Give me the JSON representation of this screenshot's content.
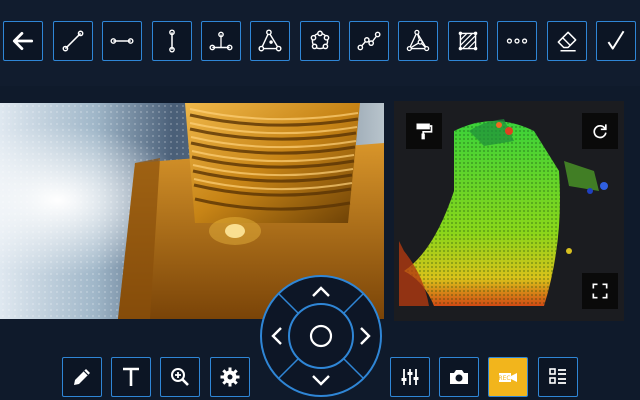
{
  "toolbar": {
    "tools": [
      {
        "name": "back-button",
        "icon": "arrow-left-icon"
      },
      {
        "name": "line-tool-button",
        "icon": "line-icon"
      },
      {
        "name": "horizontal-line-tool-button",
        "icon": "horizontal-line-icon"
      },
      {
        "name": "vertical-line-tool-button",
        "icon": "vertical-line-icon"
      },
      {
        "name": "point-to-line-tool-button",
        "icon": "point-line-icon"
      },
      {
        "name": "plane-depth-tool-button",
        "icon": "triangle-points-icon"
      },
      {
        "name": "circle-points-tool-button",
        "icon": "circle-points-icon"
      },
      {
        "name": "polyline-tool-button",
        "icon": "polyline-icon"
      },
      {
        "name": "area-mesh-tool-button",
        "icon": "mesh-icon"
      },
      {
        "name": "hatch-area-tool-button",
        "icon": "hatch-icon"
      },
      {
        "name": "more-tools-button",
        "icon": "more-icon"
      },
      {
        "name": "eraser-button",
        "icon": "eraser-icon"
      },
      {
        "name": "confirm-button",
        "icon": "check-icon"
      }
    ]
  },
  "viewer": {
    "paint_button_icon": "paint-roller-icon",
    "rotate_button_icon": "rotate-icon",
    "fullscreen_button_icon": "fullscreen-icon"
  },
  "bottombar": {
    "left_tools": [
      "pencil-icon",
      "text-icon",
      "zoom-icon",
      "settings-icon"
    ],
    "right_tools": [
      "sliders-icon",
      "camera-icon",
      "video-record-icon",
      "list-icon"
    ],
    "active_tool": "video-record-icon"
  },
  "colors": {
    "accent": "#2f86d6",
    "background": "#0f1a2b",
    "active": "#f2b51c"
  }
}
